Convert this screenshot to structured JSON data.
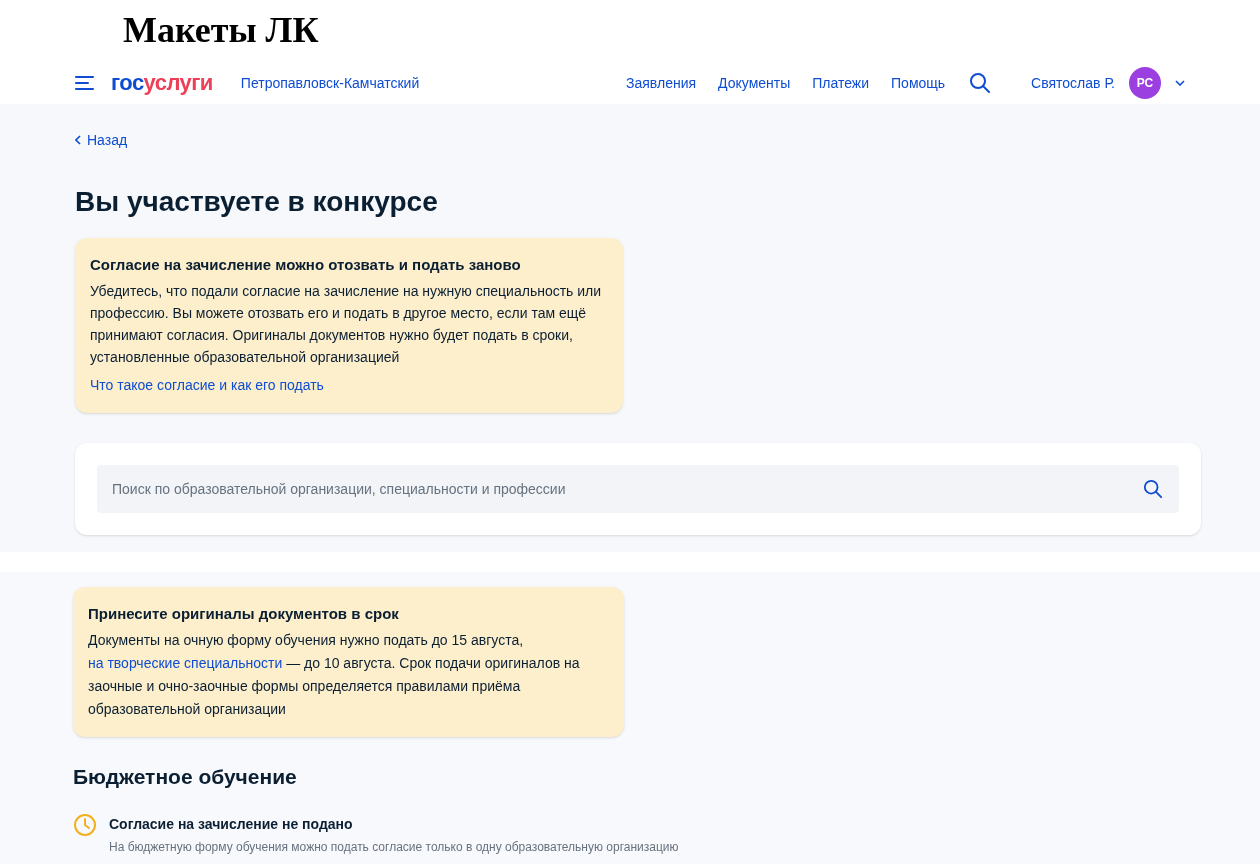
{
  "doc_title": "Макеты ЛК",
  "header": {
    "logo": {
      "part_1": "гос",
      "part_2": "услуги"
    },
    "city": "Петропавловск-Камчатский",
    "nav": [
      "Заявления",
      "Документы",
      "Платежи",
      "Помощь"
    ],
    "user_name": "Святослав Р.",
    "avatar_initials": "РС"
  },
  "back_link": "Назад",
  "page_title": "Вы участвуете в конкурсе",
  "consent_notice": {
    "title": "Согласие на зачисление можно отозвать и подать заново",
    "body": "Убедитесь, что подали согласие на зачисление на нужную специальность или профессию. Вы можете отозвать его и подать в другое место, если там ещё принимают согласия. Оригиналы документов нужно будет подать в сроки, установленные образовательной организацией",
    "link": "Что такое согласие и как его подать"
  },
  "search": {
    "placeholder": "Поиск по образовательной организации, специальности и профессии"
  },
  "originals_notice": {
    "title": "Принесите оригиналы документов в срок",
    "body_before": "Документы на очную форму обучения нужно подать до 15 августа,",
    "link": "на творческие специальности",
    "body_after": "— до 10 августа. Срок подачи оригиналов на заочные и очно-заочные формы определяется правилами приёма образовательной организации"
  },
  "section_title": "Бюджетное обучение",
  "status": {
    "title": "Согласие на зачисление не подано",
    "description": "На бюджетную форму обучения можно подать согласие только в одну образовательную организацию"
  }
}
